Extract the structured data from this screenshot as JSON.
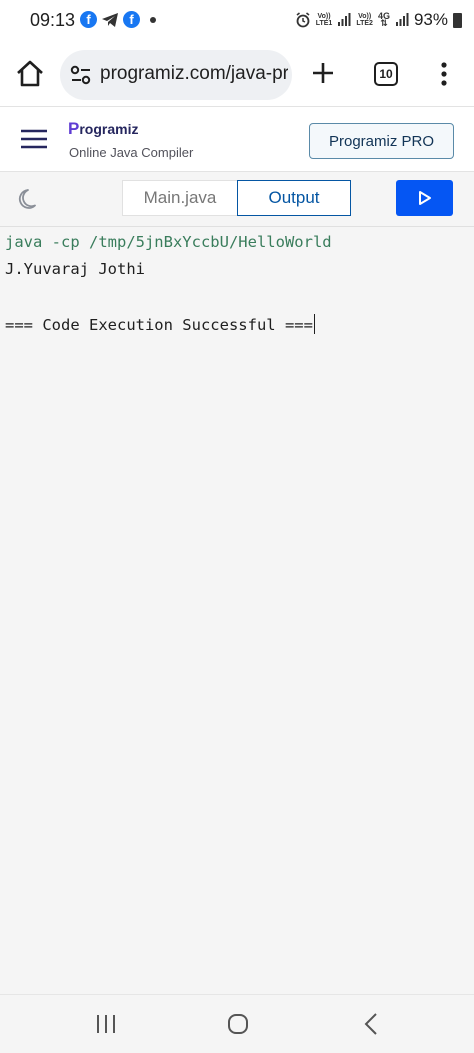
{
  "status_bar": {
    "time": "09:13",
    "sim1_label_top": "Vo))",
    "sim1_label_bottom": "LTE1",
    "sim2_label_top": "Vo))",
    "sim2_label_bottom": "LTE2",
    "network_type": "4G",
    "battery": "93%",
    "icons": [
      "facebook-icon",
      "telegram-icon",
      "facebook-icon",
      "notification-dot-icon",
      "alarm-icon",
      "signal-icon",
      "signal-icon",
      "battery-icon"
    ]
  },
  "browser": {
    "url": "programiz.com/java-programming/online-compiler",
    "tab_count": "10",
    "icons": [
      "home-icon",
      "site-info-icon",
      "plus-icon",
      "tabs-icon",
      "more-vert-icon"
    ]
  },
  "site": {
    "logo_initial": "P",
    "logo_rest": "rogramiz",
    "subtitle": "Online Java Compiler",
    "pro_label": "Programiz PRO",
    "brand_color": "#5f3cd3"
  },
  "toolbar": {
    "tab_main": "Main.java",
    "tab_output": "Output",
    "run_color": "#0556f3",
    "icons": [
      "moon-icon",
      "play-icon"
    ]
  },
  "output": {
    "command": "java -cp /tmp/5jnBxYccbU/HelloWorld",
    "lines": [
      "J.Yuvaraj Jothi",
      "",
      "=== Code Execution Successful ==="
    ],
    "command_color": "#3a7d5c"
  },
  "nav": {
    "icons": [
      "recents-icon",
      "home-circle-icon",
      "back-icon"
    ]
  }
}
